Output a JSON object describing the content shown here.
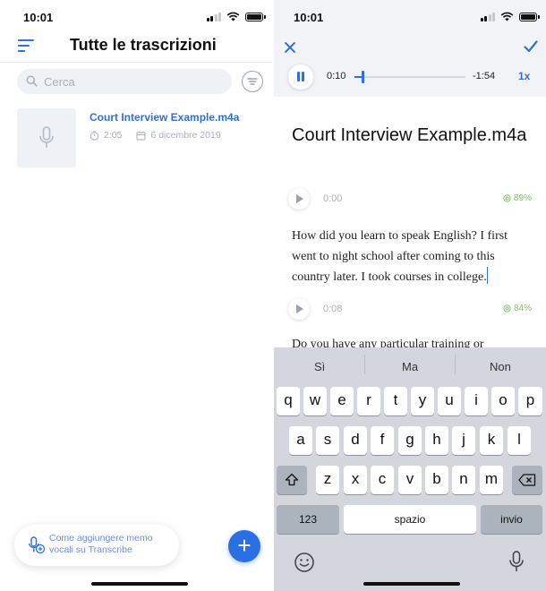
{
  "left_screen": {
    "status": {
      "time": "10:01"
    },
    "header": {
      "title": "Tutte le trascrizioni",
      "menu_icon": "menu-lines-icon",
      "accent": "#2f6fde"
    },
    "search": {
      "placeholder": "Cerca",
      "icon": "search-icon",
      "filter_icon": "filter-icon"
    },
    "recordings": [
      {
        "name": "Court Interview Example.m4a",
        "duration": "2:05",
        "date": "6 dicembre 2019",
        "icon": "microphone-icon"
      }
    ],
    "tip": {
      "text": "Come aggiungere memo vocali su Transcribe",
      "icon": "mic-plus-icon"
    },
    "fab": {
      "label": "+",
      "color": "#2a6fe4"
    }
  },
  "right_screen": {
    "status": {
      "time": "10:01"
    },
    "player": {
      "current_time": "0:10",
      "remaining_time": "-1:54",
      "speed": "1x",
      "progress": 0.08
    },
    "document": {
      "title": "Court Interview Example.m4a",
      "segments": [
        {
          "time": "0:00",
          "confidence": "89%",
          "text": "How did you learn to speak English? I first went to night school after coming to this country later. I took courses in college."
        },
        {
          "time": "0:08",
          "confidence": "84%",
          "text": "Do you have any particular training or"
        }
      ]
    },
    "keyboard": {
      "suggestions": [
        "Sì",
        "Ma",
        "Non"
      ],
      "row1": [
        "q",
        "w",
        "e",
        "r",
        "t",
        "y",
        "u",
        "i",
        "o",
        "p"
      ],
      "row2": [
        "a",
        "s",
        "d",
        "f",
        "g",
        "h",
        "j",
        "k",
        "l"
      ],
      "row3": [
        "z",
        "x",
        "c",
        "v",
        "b",
        "n",
        "m"
      ],
      "numbers_key": "123",
      "space_key": "spazio",
      "return_key": "invio"
    }
  }
}
